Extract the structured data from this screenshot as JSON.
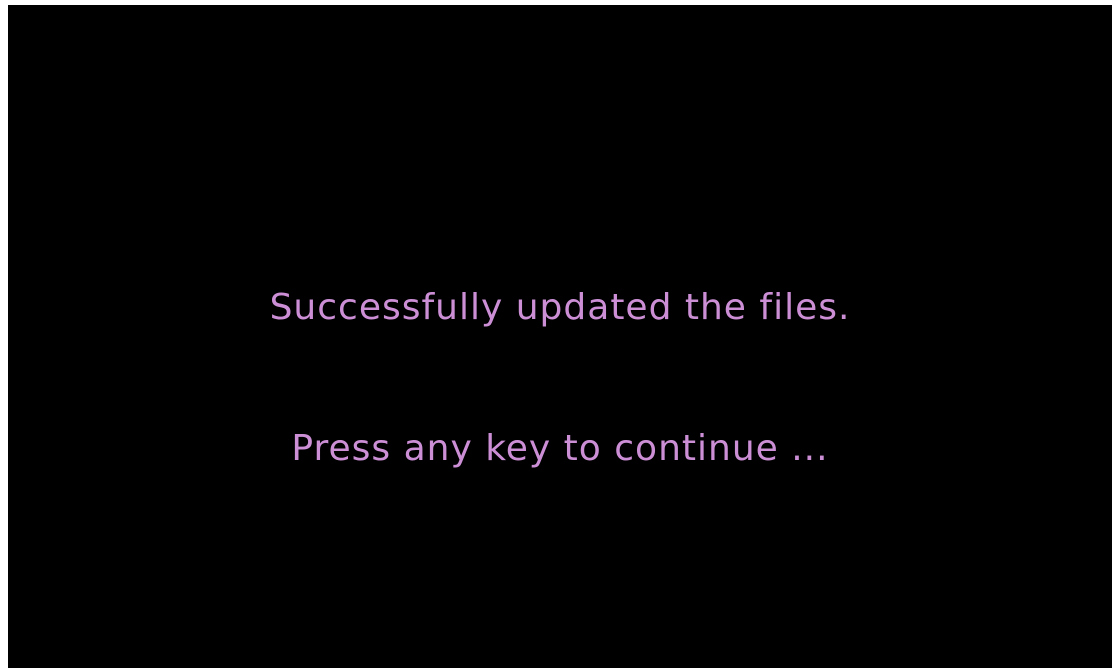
{
  "screen": {
    "message": "Successfully updated the files.",
    "prompt": "Press any key to continue ..."
  },
  "colors": {
    "background": "#000000",
    "text": "#cc8fd6",
    "border": "#ffffff"
  }
}
